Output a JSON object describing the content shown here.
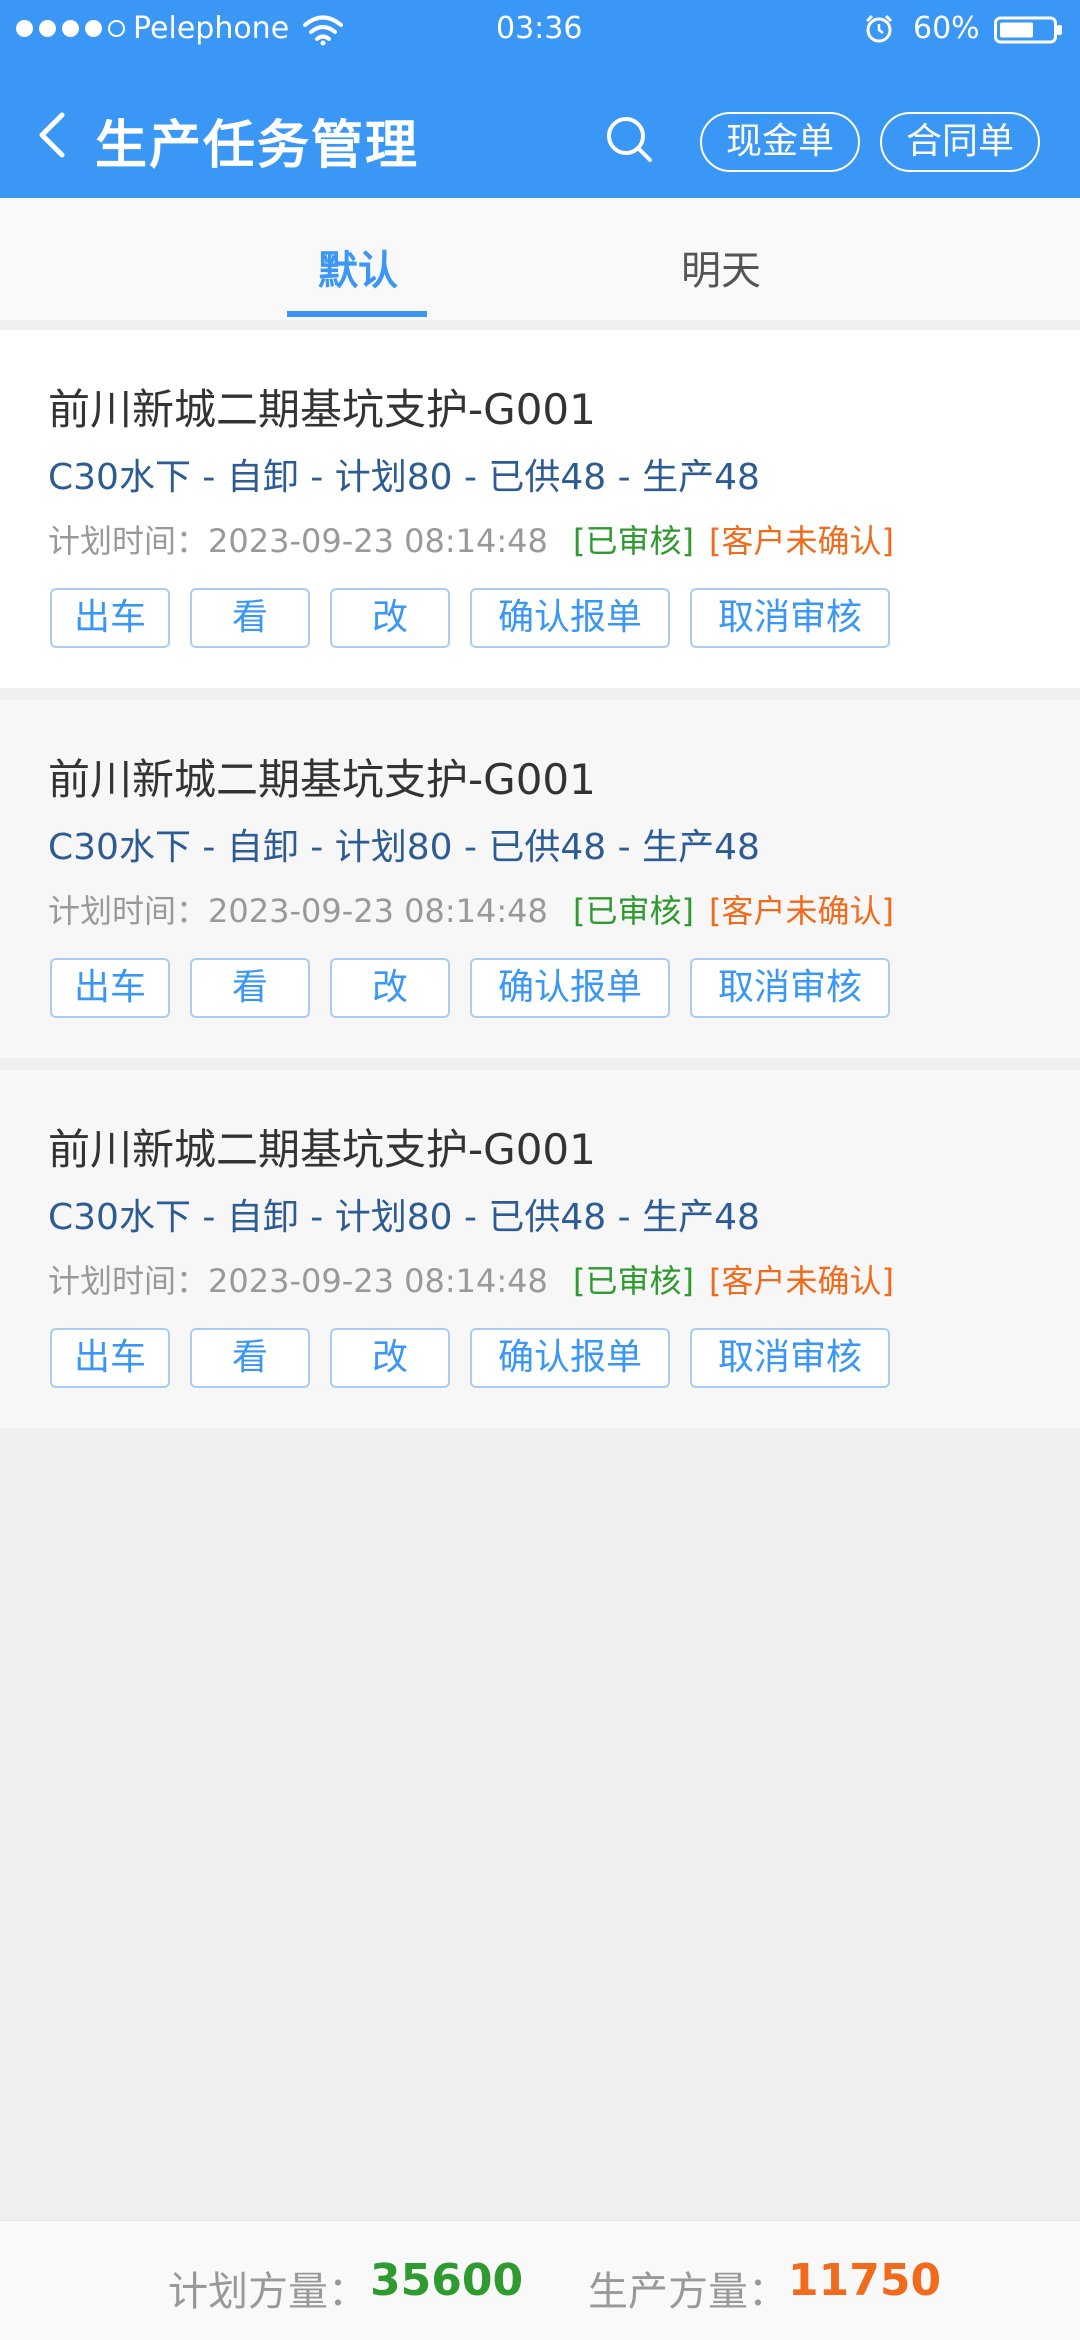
{
  "status_bar": {
    "carrier": "Pelephone",
    "time": "03:36",
    "battery": "60%",
    "signal_dots": [
      true,
      true,
      true,
      true,
      false
    ]
  },
  "nav": {
    "title": "生产任务管理",
    "cash_button": "现金单",
    "contract_button": "合同单"
  },
  "tabs": [
    {
      "label": "默认",
      "active": true
    },
    {
      "label": "明天",
      "active": false
    }
  ],
  "tasks": [
    {
      "title": "前川新城二期基坑支护-G001",
      "detail": "C30水下 - 自卸 - 计划80 - 已供48 - 生产48",
      "time": "计划时间：2023-09-23 08:14:48",
      "status": "[已审核]",
      "confirm": "[客户未确认]",
      "actions": [
        "出车",
        "看",
        "改",
        "确认报单",
        "取消审核"
      ]
    },
    {
      "title": "前川新城二期基坑支护-G001",
      "detail": "C30水下 - 自卸 - 计划80 - 已供48 - 生产48",
      "time": "计划时间：2023-09-23 08:14:48",
      "status": "[已审核]",
      "confirm": "[客户未确认]",
      "actions": [
        "出车",
        "看",
        "改",
        "确认报单",
        "取消审核"
      ]
    },
    {
      "title": "前川新城二期基坑支护-G001",
      "detail": "C30水下 - 自卸 - 计划80 - 已供48 - 生产48",
      "time": "计划时间：2023-09-23 08:14:48",
      "status": "[已审核]",
      "confirm": "[客户未确认]",
      "actions": [
        "出车",
        "看",
        "改",
        "确认报单",
        "取消审核"
      ]
    }
  ],
  "footer": {
    "plan_label": "计划方量：",
    "plan_value": "35600",
    "prod_label": "生产方量：",
    "prod_value": "11750"
  },
  "colors": {
    "primary": "#3a97f5",
    "approved": "#2f9a2f",
    "unconfirmed": "#f26a1b",
    "detail": "#2d5b93"
  }
}
